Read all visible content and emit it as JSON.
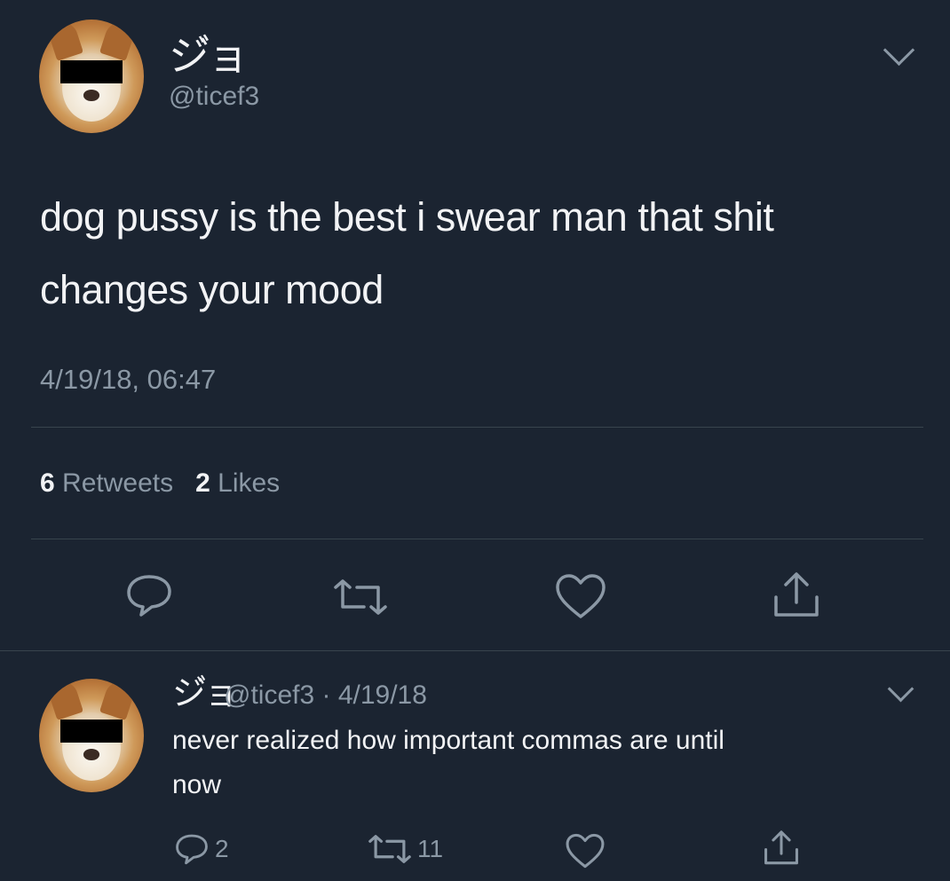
{
  "tweet": {
    "display_name": "ジ゙ョ",
    "handle": "@ticef3",
    "text_line1": "dog pussy is the best i swear man that shit",
    "text_line2": "changes your mood",
    "timestamp": "4/19/18, 06:47",
    "retweet_count": "6",
    "retweet_label": "Retweets",
    "like_count": "2",
    "like_label": "Likes",
    "actions": [
      {
        "icon": "reply-icon"
      },
      {
        "icon": "retweet-icon"
      },
      {
        "icon": "heart-icon"
      },
      {
        "icon": "share-icon"
      }
    ]
  },
  "reply": {
    "display_name": "ジ゙ョ",
    "meta": "@ticef3 · 4/19/18",
    "text_line1": "never realized how important commas are until",
    "text_line2": "now",
    "reply_count": "2",
    "retweet_count": "11"
  },
  "colors": {
    "background": "#1b2431",
    "text": "#f2f3f5",
    "secondary": "#8b98a5",
    "divider": "#38444d"
  }
}
